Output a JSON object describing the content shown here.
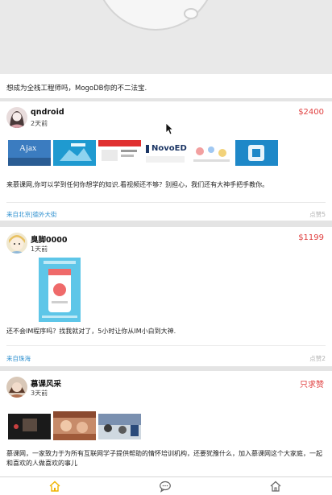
{
  "feed": {
    "top_card": {
      "desc": "想成为全栈工程师吗，MogoDB你的不二法宝."
    },
    "posts": [
      {
        "username": "qndroid",
        "time": "2天前",
        "price": "$2400",
        "desc": "来慕课网,你可以学到任何你想学的知识.看视频还不够？别担心，我们还有大神手把手教你。",
        "location": "来自北京|德外大街",
        "likes": "点赞5",
        "thumb_labels": [
          "Ajax",
          "NovoED"
        ]
      },
      {
        "username": "臭脚0000",
        "time": "1天前",
        "price": "$1199",
        "desc": "还不会IM程序吗？找我就对了，5小时让你从IM小白到大神.",
        "location": "来自珠海",
        "likes": "点赞2"
      },
      {
        "username": "慕课风采",
        "time": "3天前",
        "price": "只求赞",
        "desc": "慕课网，一家致力于为所有互联网学子提供帮助的情怀培训机构，还要犹豫什么，加入慕课网这个大家庭，一起和喜欢的人做喜欢的事儿"
      }
    ]
  },
  "tabbar": {
    "icons": [
      "home-icon",
      "chat-icon",
      "home-icon"
    ]
  },
  "colors": {
    "price": "#e04040",
    "location": "#2c8fcf",
    "tab_active": "#f0b400"
  }
}
